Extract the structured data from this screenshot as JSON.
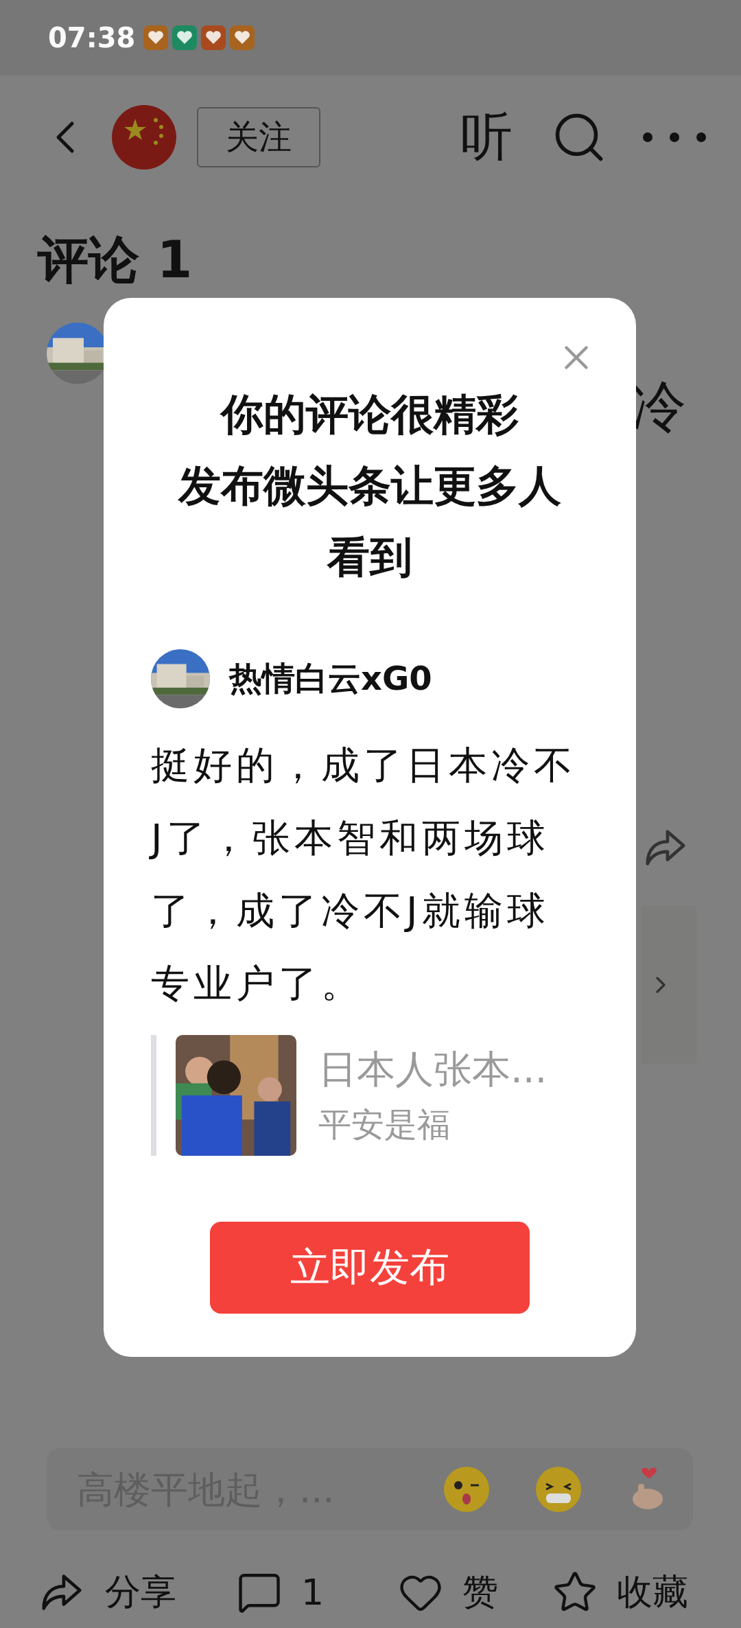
{
  "status_bar": {
    "time": "07:38"
  },
  "header": {
    "follow_button": "关注",
    "listen_button": "听"
  },
  "comments_section": {
    "title": "评论 1",
    "comment_fragment": "冷"
  },
  "dialog": {
    "title_lines": [
      "你的评论很精彩",
      "发布微头条让更多人",
      "看到"
    ],
    "user": {
      "name": "热情白云xG0"
    },
    "comment": "挺好的，成了日本冷不J了，张本智和两场球了，成了冷不J就输球专业户了。",
    "quote": {
      "title": "日本人张本...",
      "author": "平安是福"
    },
    "publish_button": "立即发布"
  },
  "comment_input": {
    "placeholder": "高楼平地起，..."
  },
  "action_bar": [
    {
      "kind": "share",
      "label": "分享"
    },
    {
      "kind": "comment",
      "label": "1"
    },
    {
      "kind": "like",
      "label": "赞"
    },
    {
      "kind": "favorite",
      "label": "收藏"
    }
  ]
}
